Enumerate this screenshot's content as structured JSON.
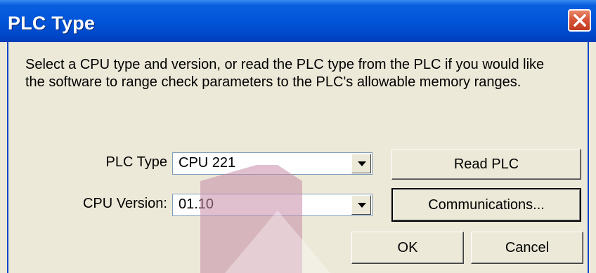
{
  "window": {
    "title": "PLC Type"
  },
  "description": {
    "line1": "Select a CPU type and version, or read the PLC type from the PLC if you would like",
    "line2": "the software to range check parameters to the PLC's allowable memory ranges."
  },
  "plc_type": {
    "label": "PLC Type",
    "value": "CPU 221"
  },
  "cpu_version": {
    "label": "CPU Version:",
    "value": "01.10"
  },
  "buttons": {
    "read_plc": "Read PLC",
    "communications": "Communications...",
    "ok": "OK",
    "cancel": "Cancel"
  },
  "icons": {
    "close": "close-icon",
    "dropdown": "chevron-down-icon"
  },
  "colors": {
    "titlebar": "#0254d8",
    "dialog_bg": "#ece9d8",
    "close_button": "#d8543a",
    "watermark": "#c68aa8"
  }
}
